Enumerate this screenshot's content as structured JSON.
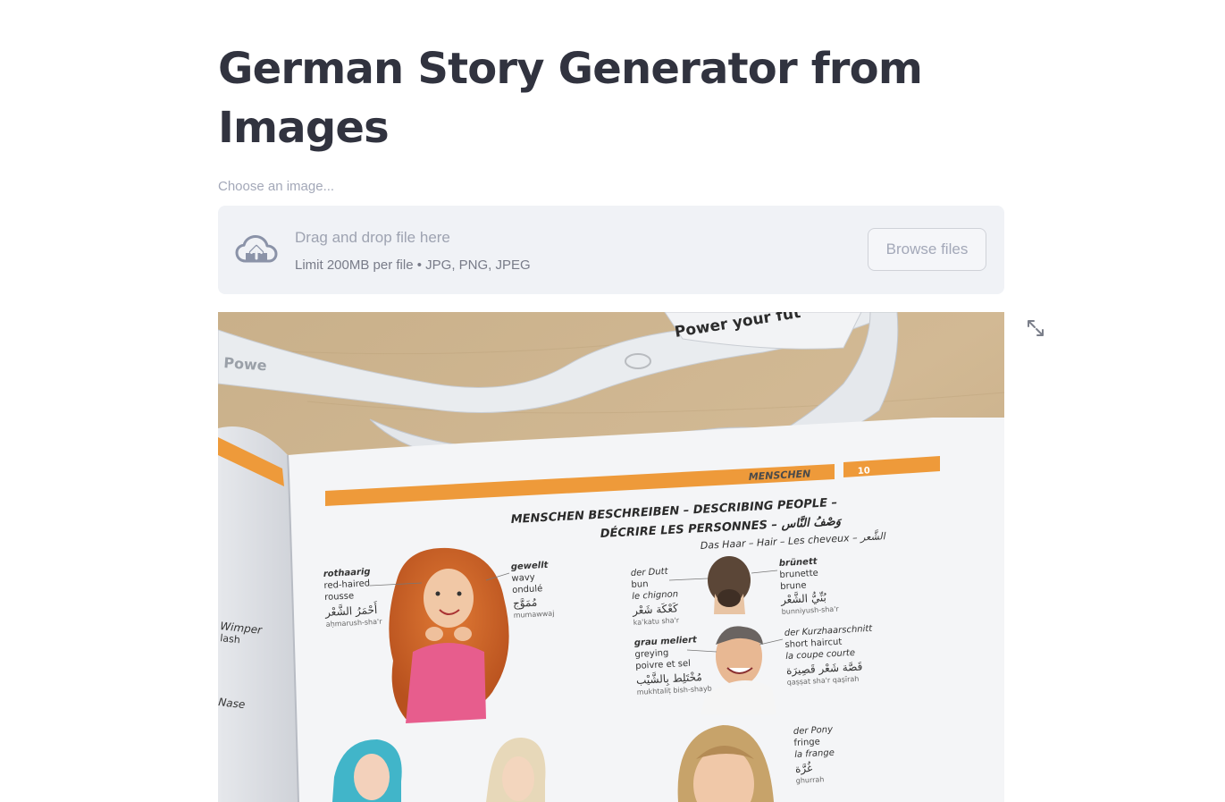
{
  "title": "German Story Generator from Images",
  "uploader": {
    "label": "Choose an image...",
    "drag_text": "Drag and drop file here",
    "limit_text": "Limit 200MB per file • JPG, PNG, JPEG",
    "browse_label": "Browse files",
    "icon": "cloud-upload-icon"
  },
  "image": {
    "lanyard_text": "Power your fut",
    "lanyard_text_left": "Powe",
    "section": "MENSCHEN",
    "page_number": "10",
    "heading_line1": "MENSCHEN BESCHREIBEN – DESCRIBING PEOPLE –",
    "heading_line2": "DÉCRIRE LES PERSONNES – وَصْفُ النَّاس",
    "subheading": "Das Haar – Hair – Les cheveux – الشَّعر",
    "labels": {
      "rothaarig": [
        "rothaarig",
        "red-haired",
        "rousse",
        "أَحْمَرُ الشَّعْر",
        "aḥmarush-sha'r"
      ],
      "gewellt": [
        "gewellt",
        "wavy",
        "ondulé",
        "مُمَوَّج",
        "mumawwaj"
      ],
      "dutt": [
        "der Dutt",
        "bun",
        "le chignon",
        "كَعْكَة شَعْر",
        "ka'katu sha'r"
      ],
      "bruenett": [
        "brünett",
        "brunette",
        "brune",
        "بُنِّيُّ الشَّعْر",
        "bunniyush-sha'r"
      ],
      "grau": [
        "grau meliert",
        "greying",
        "poivre et sel",
        "مُخْتَلِط بِالشَّيْب",
        "mukhtaliṭ bish-shayb"
      ],
      "kurz": [
        "der Kurzhaarschnitt",
        "short haircut",
        "la coupe courte",
        "قَصَّة شَعْر قَصِيرَة",
        "qaṣṣat sha'r qaṣīrah"
      ],
      "pony": [
        "der Pony",
        "fringe",
        "la frange",
        "غُرَّة",
        "ghurrah"
      ],
      "edge": [
        "Wimper",
        "lash",
        "Nase"
      ]
    }
  },
  "fullscreen_icon": "fullscreen-expand-icon",
  "colors": {
    "accent_orange": "#ee9a3a",
    "text_dark": "#31333f",
    "dropzone_bg": "#f0f2f6"
  }
}
